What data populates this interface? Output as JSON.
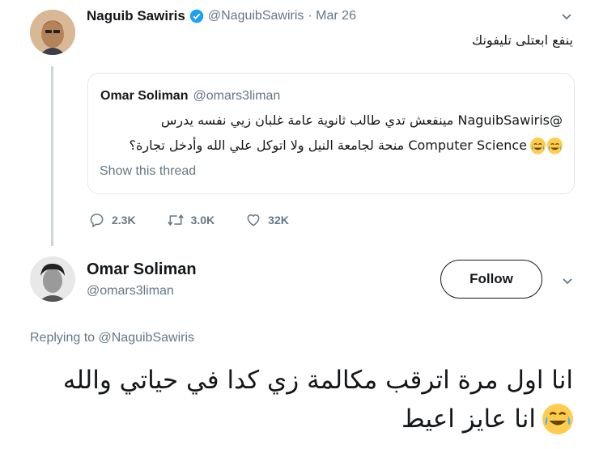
{
  "tweet": {
    "author_name": "Naguib Sawiris",
    "author_handle": "@NaguibSawiris",
    "date": "· Mar 26",
    "text": "ينفع ابعتلى تليفونك",
    "verified": true,
    "quote": {
      "author_name": "Omar Soliman",
      "author_handle": "@omars3liman",
      "line1": "@NaguibSawiris مينفعش تدي طالب ثانوية عامة غلبان زيي نفسه يدرس",
      "line2": "Computer Science منحة لجامعة النيل ولا اتوكل علي الله وأدخل تجارة؟",
      "emoji": "face-with-tears-of-joy",
      "show_thread": "Show this thread"
    },
    "actions": {
      "replies": "2.3K",
      "retweets": "3.0K",
      "likes": "32K"
    }
  },
  "reply": {
    "author_name": "Omar Soliman",
    "author_handle": "@omars3liman",
    "follow_label": "Follow",
    "replying_to_prefix": "Replying to",
    "replying_to_handle": "@NaguibSawiris",
    "line1": "انا اول مرة اترقب مكالمة زي كدا في حياتي والله",
    "line2": "انا عايز اعيط",
    "emoji": "face-with-tears-of-joy"
  },
  "colors": {
    "text": "#14171a",
    "muted": "#657786",
    "link": "#1da1f2",
    "border": "#e1e8ed",
    "verified": "#1da1f2"
  }
}
